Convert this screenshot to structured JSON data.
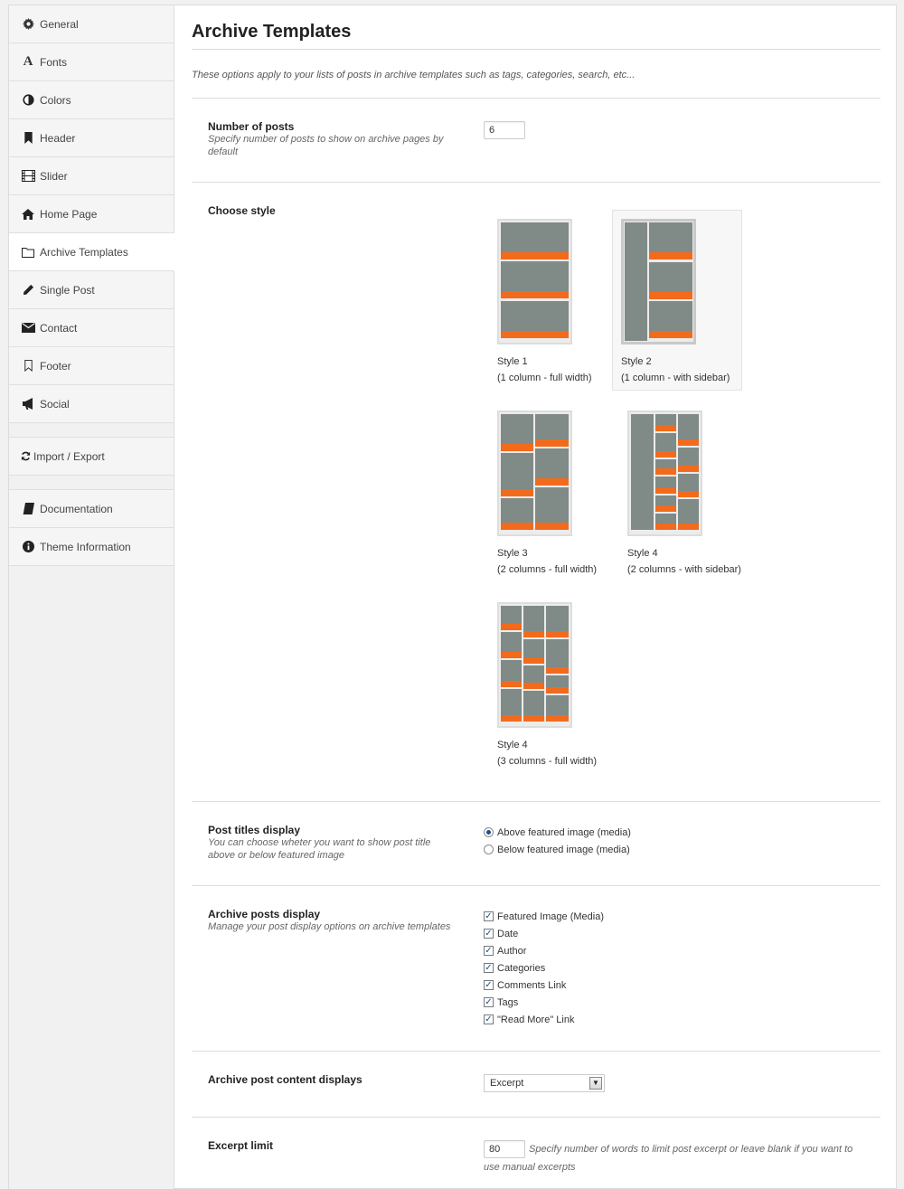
{
  "sidebar": {
    "items": [
      {
        "label": "General",
        "icon": "gear-icon"
      },
      {
        "label": "Fonts",
        "icon": "font-icon"
      },
      {
        "label": "Colors",
        "icon": "contrast-icon"
      },
      {
        "label": "Header",
        "icon": "bookmark-icon"
      },
      {
        "label": "Slider",
        "icon": "film-icon"
      },
      {
        "label": "Home Page",
        "icon": "home-icon"
      },
      {
        "label": "Archive Templates",
        "icon": "folder-icon",
        "active": true
      },
      {
        "label": "Single Post",
        "icon": "pencil-icon"
      },
      {
        "label": "Contact",
        "icon": "envelope-icon"
      },
      {
        "label": "Footer",
        "icon": "bookmark-outline-icon"
      },
      {
        "label": "Social",
        "icon": "megaphone-icon"
      }
    ],
    "tools": [
      {
        "label": "Import / Export",
        "icon": "refresh-icon"
      }
    ],
    "info": [
      {
        "label": "Documentation",
        "icon": "book-icon"
      },
      {
        "label": "Theme Information",
        "icon": "info-icon"
      }
    ]
  },
  "main": {
    "title": "Archive Templates",
    "intro": "These options apply to your lists of posts in archive templates such as tags, categories, search, etc...",
    "number_of_posts": {
      "label": "Number of posts",
      "desc": "Specify number of posts to show on archive pages by default",
      "value": "6"
    },
    "choose_style": {
      "label": "Choose style",
      "styles": [
        {
          "name": "Style 1",
          "caption": "(1 column - full width)",
          "selected": false
        },
        {
          "name": "Style 2",
          "caption": "(1 column - with sidebar)",
          "selected": true
        },
        {
          "name": "Style 3",
          "caption": "(2 columns - full width)",
          "selected": false
        },
        {
          "name": "Style 4",
          "caption": "(2 columns - with sidebar)",
          "selected": false
        },
        {
          "name": "Style 4",
          "caption": "(3 columns - full width)",
          "selected": false
        }
      ]
    },
    "post_titles": {
      "label": "Post titles display",
      "desc": "You can choose wheter you want to show post title above or below featured image",
      "options": [
        {
          "label": "Above featured image (media)",
          "checked": true
        },
        {
          "label": "Below featured image (media)",
          "checked": false
        }
      ]
    },
    "archive_posts_display": {
      "label": "Archive posts display",
      "desc": "Manage your post display options on archive templates",
      "options": [
        {
          "label": "Featured Image (Media)",
          "checked": true
        },
        {
          "label": "Date",
          "checked": true
        },
        {
          "label": "Author",
          "checked": true
        },
        {
          "label": "Categories",
          "checked": true
        },
        {
          "label": "Comments Link",
          "checked": true
        },
        {
          "label": "Tags",
          "checked": true
        },
        {
          "label": "\"Read More\" Link",
          "checked": true
        }
      ]
    },
    "content_displays": {
      "label": "Archive post content displays",
      "selected": "Excerpt"
    },
    "excerpt_limit": {
      "label": "Excerpt limit",
      "value": "80",
      "desc_line1": "Specify number of words to limit post excerpt or leave blank if you want to",
      "desc_line2": "use manual excerpts"
    }
  },
  "colors": {
    "accent": "#f26b1d",
    "thumb_block": "#808a87",
    "check": "#1c4f8a"
  }
}
